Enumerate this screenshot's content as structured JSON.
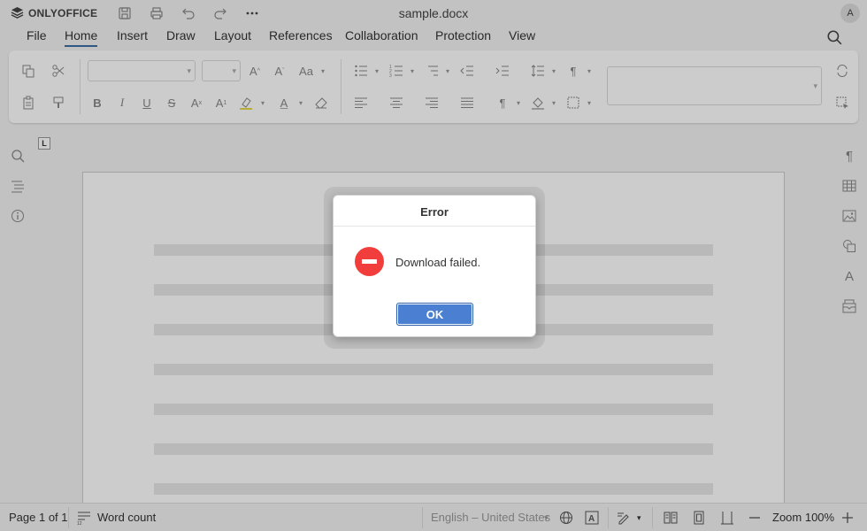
{
  "app": {
    "brand": "ONLYOFFICE",
    "document_title": "sample.docx",
    "user_initial": "A"
  },
  "menu": {
    "tabs": [
      {
        "label": "File"
      },
      {
        "label": "Home"
      },
      {
        "label": "Insert"
      },
      {
        "label": "Draw"
      },
      {
        "label": "Layout"
      },
      {
        "label": "References"
      },
      {
        "label": "Collaboration"
      },
      {
        "label": "Protection"
      },
      {
        "label": "View"
      }
    ],
    "active_tab": "Home"
  },
  "toolbar": {
    "font_name": "",
    "font_size": "",
    "style_preset": ""
  },
  "ruler": {
    "tab_marker": "L"
  },
  "dialog": {
    "title": "Error",
    "message": "Download failed.",
    "ok_label": "OK",
    "icon": "error-icon"
  },
  "status": {
    "page_info": "Page 1 of 1",
    "word_count": "Word count",
    "language": "English – United States",
    "zoom": "Zoom 100%"
  },
  "colors": {
    "active_tab_underline": "#3c6ea5",
    "ok_button": "#4a7fd1",
    "error_icon": "#f23d3d",
    "highlight_bar": "#e6d84a"
  }
}
